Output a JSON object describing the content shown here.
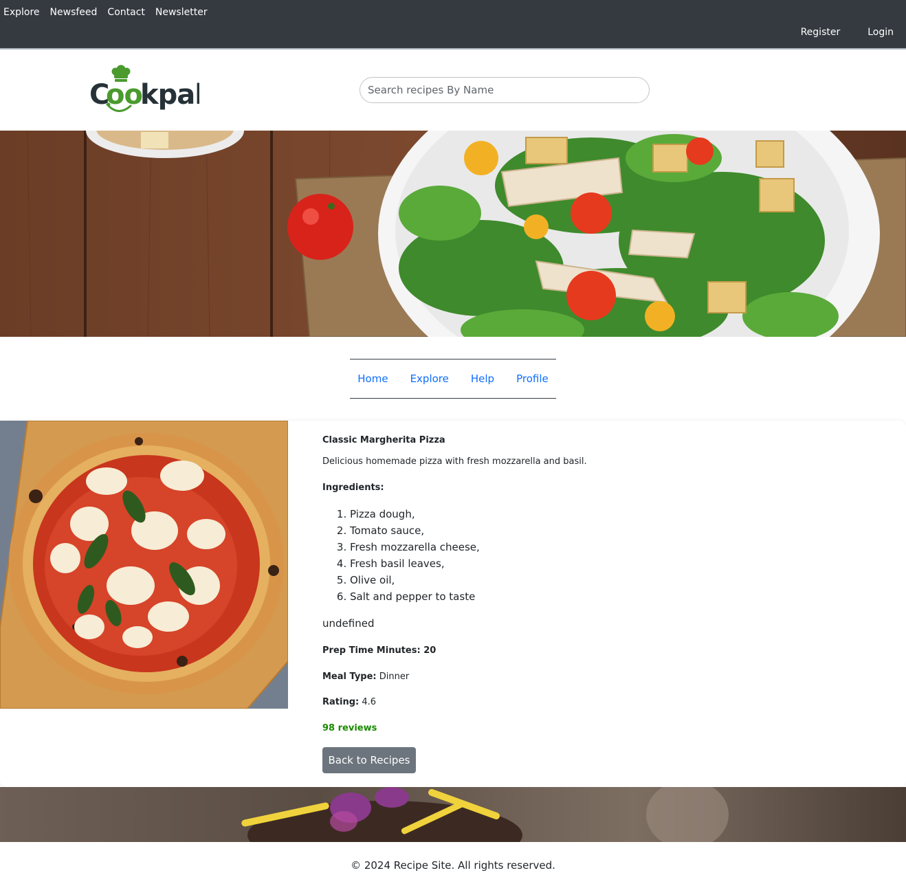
{
  "topnav": {
    "left": [
      "Explore",
      "Newsfeed",
      "Contact",
      "Newsletter"
    ],
    "right": [
      "Register",
      "Login"
    ]
  },
  "header": {
    "logo_text": "Cookpal",
    "search_placeholder": "Search recipes By Name"
  },
  "subnav": [
    "Home",
    "Explore",
    "Help",
    "Profile"
  ],
  "recipe": {
    "name": "Classic Margherita Pizza",
    "description": "Delicious homemade pizza with fresh mozzarella and basil.",
    "ingredients_label": "Ingredients:",
    "ingredients": [
      "Pizza dough,",
      "Tomato sauce,",
      "Fresh mozzarella cheese,",
      "Fresh basil leaves,",
      "Olive oil,",
      "Salt and pepper to taste"
    ],
    "instructions": "undefined",
    "prep_time_text": "Prep Time Minutes: 20",
    "meal_type_label": "Meal Type:",
    "meal_type_value": "Dinner",
    "rating_label": "Rating:",
    "rating_value": "4.6",
    "reviews": "98 reviews",
    "back_label": "Back to Recipes"
  },
  "footer": "© 2024 Recipe Site. All rights reserved.",
  "colors": {
    "topbar": "#343a40",
    "link": "#0d6efd",
    "reviews": "#198a00",
    "button": "#6c757d"
  }
}
